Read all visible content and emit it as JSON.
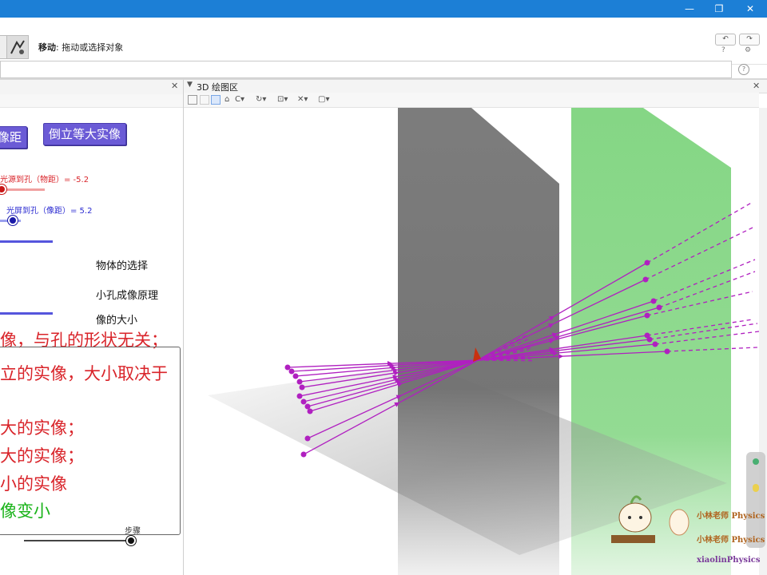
{
  "window": {
    "controls": [
      "—",
      "❐",
      "✕"
    ]
  },
  "toolbar": {
    "mode_name": "移动",
    "mode_desc": ": 拖动或选择对象",
    "undo": "↶",
    "redo": "↷",
    "help_small": "?",
    "settings_small": "⚙"
  },
  "input_bar": {
    "help": "?"
  },
  "left_panel": {
    "close": "✕",
    "buttons": {
      "image_distance": "像距",
      "inverted_equal": "倒立等大实像"
    },
    "slider_object": {
      "label": "光源到孔（物距）= -5.2",
      "value": -5.2,
      "fill": 0.05
    },
    "slider_image": {
      "label": "光屏到孔（像距）= 5.2",
      "value": 5.2,
      "fill": 0.6
    },
    "items": [
      "物体的选择",
      "小孔成像原理",
      "像的大小"
    ],
    "text_lines": [
      "像，与孔的形状无关；",
      "立的实像，大小取决于",
      "大的实像；",
      "大的实像；",
      "小的实像",
      "像变小"
    ],
    "step_label": "步骤",
    "step_value": 1.0
  },
  "view3d": {
    "title": "3D 绘图区",
    "close": "✕",
    "tools": [
      "⌂",
      "C▾",
      "↻▾",
      "⊡▾",
      "✕▾",
      "▢▾"
    ]
  },
  "watermark": {
    "lines": [
      "小林老师 Physics",
      "小林老师 Physics",
      "xiaolinPhysics"
    ]
  },
  "colors": {
    "accent": "#1c7fd6",
    "button": "#6b5bd6",
    "red_text": "#d9242a",
    "blue_text": "#2b2bd1",
    "green_text": "#19b319",
    "ray": "#b020c0",
    "screen_green": "#6fcf6f"
  }
}
